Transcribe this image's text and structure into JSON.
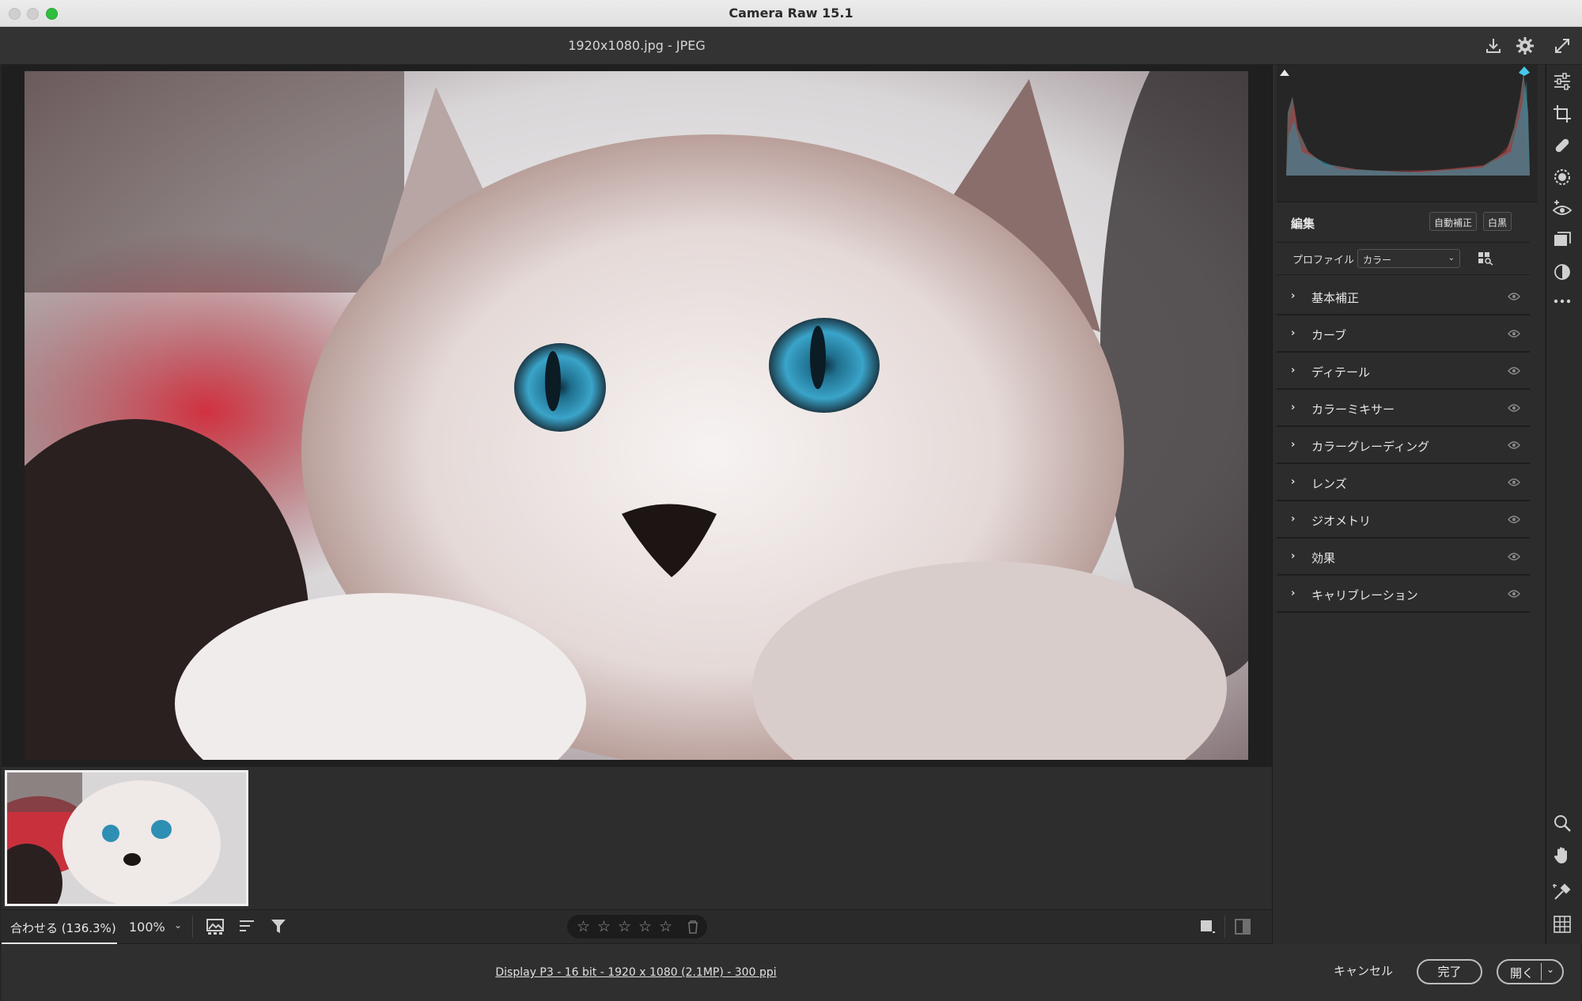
{
  "window": {
    "title": "Camera Raw 15.1"
  },
  "header": {
    "file_title": "1920x1080.jpg  -  JPEG"
  },
  "toolbar": {
    "zoom_fit_label": "合わせる (136.3%)",
    "zoom_level": "100%",
    "rating_stars": 0,
    "icons": [
      "filmstrip-options-icon",
      "sort-icon",
      "filter-icon",
      "view-mode-icon",
      "before-after-icon"
    ]
  },
  "footer": {
    "info": "Display P3 - 16 bit - 1920 x 1080 (2.1MP) - 300 ppi",
    "cancel_label": "キャンセル",
    "done_label": "完了",
    "open_label": "開く"
  },
  "edit_panel": {
    "title": "編集",
    "auto_label": "自動補正",
    "bw_label": "白黒",
    "profile_label": "プロファイル",
    "profile_value": "カラー",
    "sections": [
      {
        "label": "基本補正"
      },
      {
        "label": "カーブ"
      },
      {
        "label": "ディテール"
      },
      {
        "label": "カラーミキサー"
      },
      {
        "label": "カラーグレーディング"
      },
      {
        "label": "レンズ"
      },
      {
        "label": "ジオメトリ"
      },
      {
        "label": "効果"
      },
      {
        "label": "キャリブレーション"
      }
    ]
  },
  "tools": [
    "edit-icon",
    "crop-icon",
    "heal-icon",
    "mask-icon",
    "redeye-icon",
    "snapshots-icon",
    "presets-icon",
    "more-icon",
    "zoom-icon",
    "hand-icon",
    "sampler-icon",
    "grid-icon"
  ],
  "colors": {
    "accent": "#2fbe3e",
    "panel": "#2c2c2c",
    "canvas": "#1f1f1f"
  }
}
